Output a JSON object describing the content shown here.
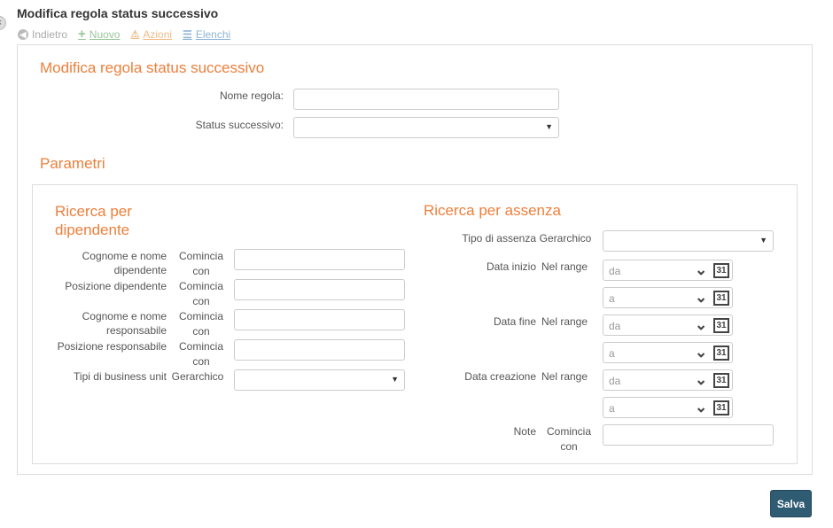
{
  "page": {
    "title": "Modifica regola status successivo"
  },
  "toolbar": {
    "back": "Indietro",
    "new": "Nuovo",
    "actions": "Azioni",
    "lists": "Elenchi"
  },
  "form": {
    "title": "Modifica regola status successivo",
    "name_label": "Nome regola:",
    "name_value": "",
    "status_label": "Status successivo:",
    "status_value": ""
  },
  "params": {
    "title": "Parametri",
    "employee": {
      "title": "Ricerca per dipendente",
      "rows": [
        {
          "label": "Cognome e nome dipendente",
          "op": "Comincia con",
          "value": ""
        },
        {
          "label": "Posizione dipendente",
          "op": "Comincia con",
          "value": ""
        },
        {
          "label": "Cognome e nome responsabile",
          "op": "Comincia con",
          "value": ""
        },
        {
          "label": "Posizione responsabile",
          "op": "Comincia con",
          "value": ""
        },
        {
          "label": "Tipi di business unit",
          "op": "Gerarchico",
          "value": ""
        }
      ]
    },
    "absence": {
      "title": "Ricerca per assenza",
      "type_label": "Tipo di assenza",
      "type_op": "Gerarchico",
      "type_value": "",
      "start_label": "Data inizio",
      "end_label": "Data fine",
      "created_label": "Data creazione",
      "range_op": "Nel range",
      "from_placeholder": "da",
      "to_placeholder": "a",
      "calendar_day": "31",
      "notes_label": "Note",
      "notes_op": "Comincia con",
      "notes_value": ""
    }
  },
  "save_label": "Salva",
  "colors": {
    "accent": "#ec7f3b",
    "save_button": "#2f5b73"
  },
  "icons": {
    "close": "close-icon",
    "back": "arrow-left-circle-icon",
    "new": "plus-icon",
    "actions": "warning-triangle-icon",
    "lists": "list-icon",
    "dropdown": "caret-down-icon",
    "calendar": "calendar-icon"
  }
}
